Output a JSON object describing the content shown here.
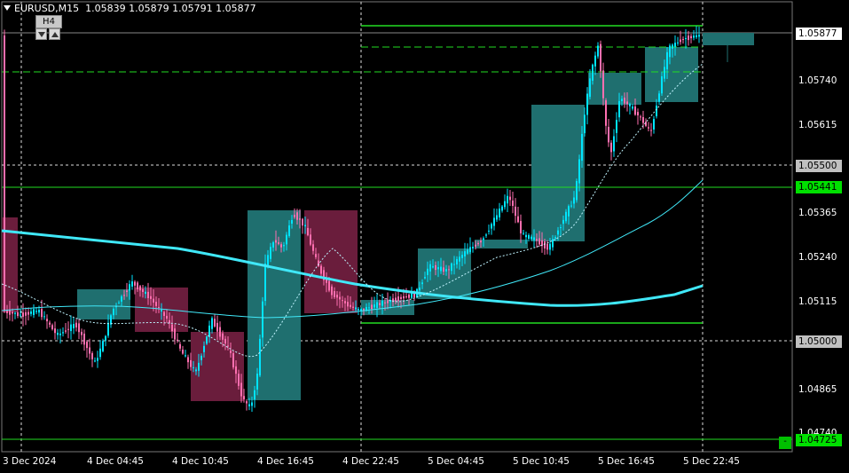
{
  "header": {
    "symbol": "EURUSD,M15",
    "open": "1.05839",
    "high": "1.05879",
    "low": "1.05791",
    "close": "1.05877"
  },
  "timeframe_box": {
    "label": "H4",
    "down_icon": "triangle-down-icon",
    "up_icon": "triangle-up-icon"
  },
  "price_axis": {
    "ticks": [
      "1.05740",
      "1.05615",
      "1.05365",
      "1.05240",
      "1.05115",
      "1.04865",
      "1.04740"
    ],
    "highlighted": [
      {
        "value": "1.05877",
        "style": "white"
      },
      {
        "value": "1.05500",
        "style": "gray"
      },
      {
        "value": "1.05441",
        "style": "green"
      },
      {
        "value": "1.05000",
        "style": "gray"
      },
      {
        "value": "1.04725",
        "style": "green"
      }
    ]
  },
  "time_axis": {
    "labels": [
      "3 Dec 2024",
      "4 Dec 04:45",
      "4 Dec 10:45",
      "4 Dec 16:45",
      "4 Dec 22:45",
      "5 Dec 04:45",
      "5 Dec 10:45",
      "5 Dec 16:45",
      "5 Dec 22:45"
    ]
  },
  "colors": {
    "background": "#000000",
    "bull_candle": "#00e5ff",
    "bear_candle": "#ff6fb0",
    "h4_bull_box": "#1f6f6f",
    "h4_bear_box": "#6a1d3c",
    "level_line": "#22dd22",
    "ma_slow": "#40e8f8",
    "grid": "#ffffff"
  },
  "corner_button": {
    "label": "-"
  }
}
